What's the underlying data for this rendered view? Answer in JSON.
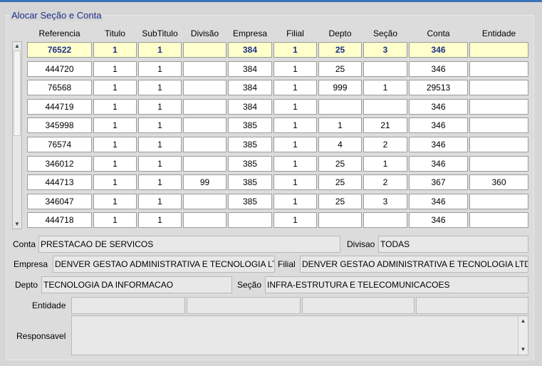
{
  "section_title": "Alocar Seção e Conta",
  "columns": [
    "Referencia",
    "Titulo",
    "SubTitulo",
    "Divisão",
    "Empresa",
    "Filial",
    "Depto",
    "Seção",
    "Conta",
    "Entidade"
  ],
  "rows": [
    [
      "76522",
      "1",
      "1",
      "",
      "384",
      "1",
      "25",
      "3",
      "346",
      ""
    ],
    [
      "444720",
      "1",
      "1",
      "",
      "384",
      "1",
      "25",
      "",
      "346",
      ""
    ],
    [
      "76568",
      "1",
      "1",
      "",
      "384",
      "1",
      "999",
      "1",
      "29513",
      ""
    ],
    [
      "444719",
      "1",
      "1",
      "",
      "384",
      "1",
      "",
      "",
      "346",
      ""
    ],
    [
      "345998",
      "1",
      "1",
      "",
      "385",
      "1",
      "1",
      "21",
      "346",
      ""
    ],
    [
      "76574",
      "1",
      "1",
      "",
      "385",
      "1",
      "4",
      "2",
      "346",
      ""
    ],
    [
      "346012",
      "1",
      "1",
      "",
      "385",
      "1",
      "25",
      "1",
      "346",
      ""
    ],
    [
      "444713",
      "1",
      "1",
      "99",
      "385",
      "1",
      "25",
      "2",
      "367",
      "360"
    ],
    [
      "346047",
      "1",
      "1",
      "",
      "385",
      "1",
      "25",
      "3",
      "346",
      ""
    ],
    [
      "444718",
      "1",
      "1",
      "",
      "",
      "1",
      "",
      "",
      "346",
      ""
    ]
  ],
  "form": {
    "conta_label": "Conta",
    "conta_value": "PRESTACAO DE SERVICOS",
    "divisao_label": "Divisao",
    "divisao_value": "TODAS",
    "empresa_label": "Empresa",
    "empresa_value": "DENVER GESTAO ADMINISTRATIVA E TECNOLOGIA LTDA",
    "filial_label": "Filial",
    "filial_value": "DENVER GESTAO ADMINISTRATIVA E TECNOLOGIA LTDA",
    "depto_label": "Depto",
    "depto_value": "TECNOLOGIA DA INFORMACAO",
    "secao_label": "Seção",
    "secao_value": "INFRA-ESTRUTURA E TELECOMUNICACOES",
    "entidade_label": "Entidade",
    "entidade_values": [
      "",
      "",
      "",
      ""
    ],
    "responsavel_label": "Responsavel",
    "responsavel_value": ""
  },
  "selected_row": 0,
  "colors": {
    "selected_bg": "#ffffcc",
    "title": "#1a2f8a",
    "accent": "#3b73b8"
  }
}
